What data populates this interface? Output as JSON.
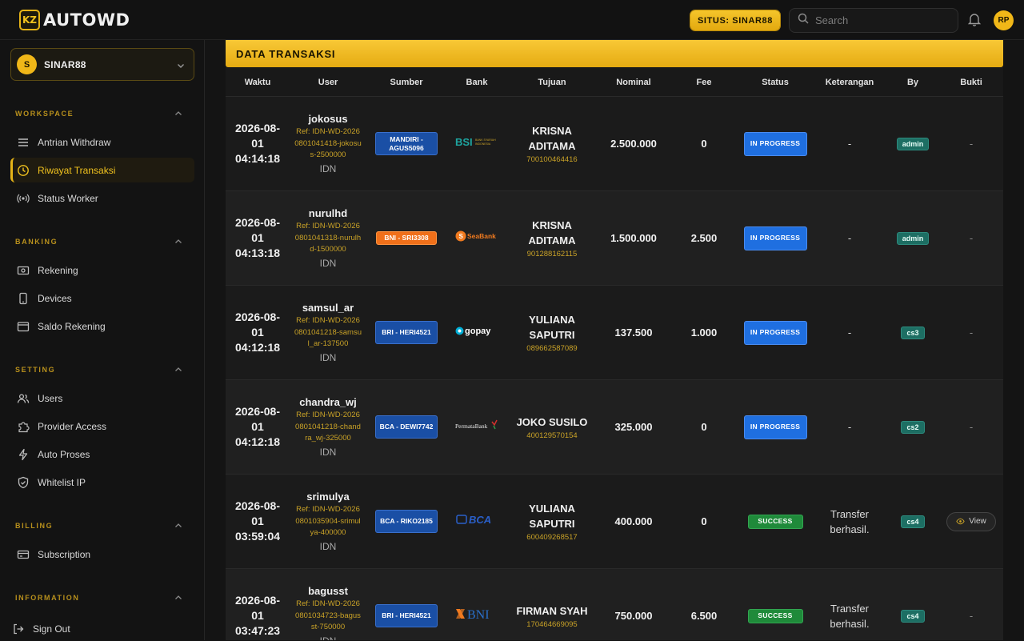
{
  "app": {
    "logo_mark": "KZ",
    "title": "AUTOWD"
  },
  "header": {
    "site_label": "SITUS: SINAR88",
    "search_placeholder": "Search",
    "user_initials": "RP"
  },
  "sidebar": {
    "workspace": {
      "initial": "S",
      "name": "SINAR88"
    },
    "sections": [
      {
        "title": "WORKSPACE",
        "items": [
          {
            "label": "Antrian Withdraw",
            "icon": "list-icon"
          },
          {
            "label": "Riwayat Transaksi",
            "icon": "clock-icon",
            "active": true
          },
          {
            "label": "Status Worker",
            "icon": "broadcast-icon"
          }
        ]
      },
      {
        "title": "BANKING",
        "items": [
          {
            "label": "Rekening",
            "icon": "money-icon"
          },
          {
            "label": "Devices",
            "icon": "phone-icon"
          },
          {
            "label": "Saldo Rekening",
            "icon": "wallet-icon"
          }
        ]
      },
      {
        "title": "SETTING",
        "items": [
          {
            "label": "Users",
            "icon": "users-icon"
          },
          {
            "label": "Provider Access",
            "icon": "puzzle-icon"
          },
          {
            "label": "Auto Proses",
            "icon": "bolt-icon"
          },
          {
            "label": "Whitelist IP",
            "icon": "shield-icon"
          }
        ]
      },
      {
        "title": "BILLING",
        "items": [
          {
            "label": "Subscription",
            "icon": "card-icon"
          }
        ]
      },
      {
        "title": "INFORMATION",
        "items": []
      }
    ],
    "sign_out": "Sign Out"
  },
  "panel": {
    "title": "DATA TRANSAKSI",
    "columns": [
      "Waktu",
      "User",
      "Sumber",
      "Bank",
      "Tujuan",
      "Nominal",
      "Fee",
      "Status",
      "Keterangan",
      "By",
      "Bukti"
    ],
    "rows": [
      {
        "time": "2026-08-01 04:14:18",
        "user": "jokosus",
        "ref": "Ref: IDN-WD-20260801041418-jokosus-2500000",
        "region": "IDN",
        "source": "MANDIRI - AGUS5096",
        "source_color": "blue",
        "bank": "BSI",
        "bank_sub": "BANK SYARIAH INDONESIA",
        "bank_color": "#1ea5a0",
        "to_name": "KRISNA ADITAMA",
        "to_acc": "700100464416",
        "nominal": "2.500.000",
        "fee": "0",
        "status": "IN PROGRESS",
        "status_kind": "prog",
        "note": "-",
        "by": "admin",
        "proof": "-"
      },
      {
        "time": "2026-08-01 04:13:18",
        "user": "nurulhd",
        "ref": "Ref: IDN-WD-20260801041318-nurulhd-1500000",
        "region": "IDN",
        "source": "BNI - SRI3308",
        "source_color": "orange",
        "bank": "SeaBank",
        "bank_sub": "",
        "bank_color": "#f07a1f",
        "to_name": "KRISNA ADITAMA",
        "to_acc": "901288162115",
        "nominal": "1.500.000",
        "fee": "2.500",
        "status": "IN PROGRESS",
        "status_kind": "prog",
        "note": "-",
        "by": "admin",
        "proof": "-"
      },
      {
        "time": "2026-08-01 04:12:18",
        "user": "samsul_ar",
        "ref": "Ref: IDN-WD-20260801041218-samsul_ar-137500",
        "region": "IDN",
        "source": "BRI - HERI4521",
        "source_color": "blue",
        "bank": "gopay",
        "bank_sub": "",
        "bank_color": "#ffffff",
        "to_name": "YULIANA SAPUTRI",
        "to_acc": "089662587089",
        "nominal": "137.500",
        "fee": "1.000",
        "status": "IN PROGRESS",
        "status_kind": "prog",
        "note": "-",
        "by": "cs3",
        "proof": "-"
      },
      {
        "time": "2026-08-01 04:12:18",
        "user": "chandra_wj",
        "ref": "Ref: IDN-WD-20260801041218-chandra_wj-325000",
        "region": "IDN",
        "source": "BCA - DEWI7742",
        "source_color": "blue",
        "bank": "PermataBank",
        "bank_sub": "",
        "bank_color": "#e8e8e8",
        "to_name": "JOKO SUSILO",
        "to_acc": "400129570154",
        "nominal": "325.000",
        "fee": "0",
        "status": "IN PROGRESS",
        "status_kind": "prog",
        "note": "-",
        "by": "cs2",
        "proof": "-"
      },
      {
        "time": "2026-08-01 03:59:04",
        "user": "srimulya",
        "ref": "Ref: IDN-WD-20260801035904-srimulya-400000",
        "region": "IDN",
        "source": "BCA - RIKO2185",
        "source_color": "blue",
        "bank": "BCA",
        "bank_sub": "",
        "bank_color": "#2a5fc9",
        "to_name": "YULIANA SAPUTRI",
        "to_acc": "600409268517",
        "nominal": "400.000",
        "fee": "0",
        "status": "SUCCESS",
        "status_kind": "succ",
        "note": "Transfer berhasil.",
        "by": "cs4",
        "proof": "View"
      },
      {
        "time": "2026-08-01 03:47:23",
        "user": "bagusst",
        "ref": "Ref: IDN-WD-20260801034723-bagusst-750000",
        "region": "IDN",
        "source": "BRI - HERI4521",
        "source_color": "blue",
        "bank": "BNI",
        "bank_sub": "",
        "bank_color": "#2a6fc9",
        "to_name": "FIRMAN SYAH",
        "to_acc": "170464669095",
        "nominal": "750.000",
        "fee": "6.500",
        "status": "SUCCESS",
        "status_kind": "succ",
        "note": "Transfer berhasil.",
        "by": "cs4",
        "proof": "-"
      }
    ]
  }
}
